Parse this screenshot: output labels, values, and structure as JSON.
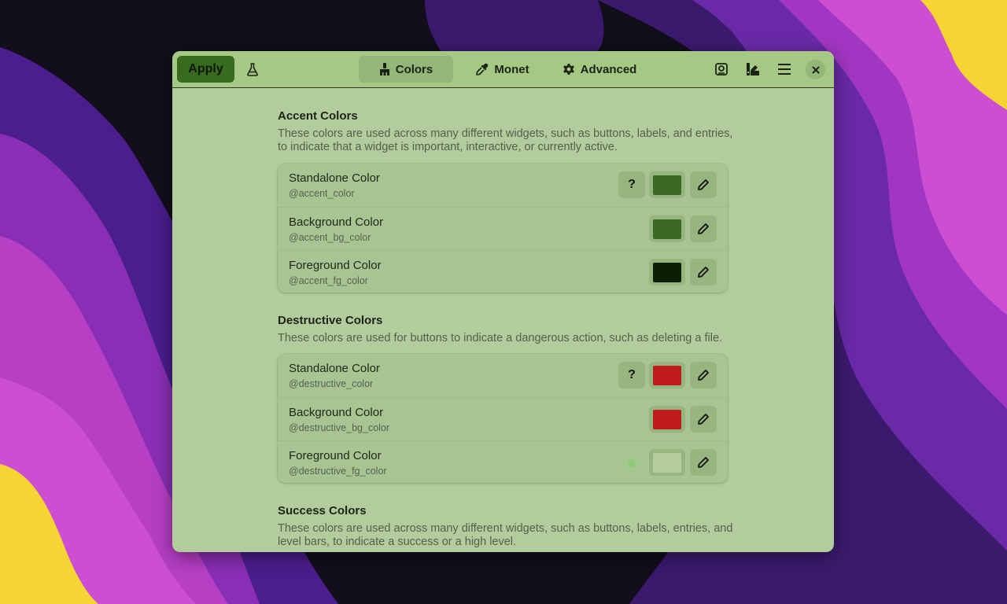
{
  "window": {
    "header": {
      "apply_label": "Apply",
      "tabs": [
        {
          "label": "Colors",
          "icon": "brush-icon",
          "active": true
        },
        {
          "label": "Monet",
          "icon": "eyedropper-icon",
          "active": false
        },
        {
          "label": "Advanced",
          "icon": "gear-icon",
          "active": false
        }
      ],
      "icons": [
        "flask-icon",
        "preset-icon",
        "palette-icon",
        "hamburger-menu-icon",
        "close-icon"
      ]
    },
    "sections": [
      {
        "title": "Accent Colors",
        "description": "These colors are used across many different widgets, such as buttons, labels, and entries, to indicate that a widget is important, interactive, or currently active.",
        "rows": [
          {
            "title": "Standalone Color",
            "subtitle": "@accent_color",
            "swatch": "#3b6b22",
            "help": true
          },
          {
            "title": "Background Color",
            "subtitle": "@accent_bg_color",
            "swatch": "#3b6b22",
            "help": false
          },
          {
            "title": "Foreground Color",
            "subtitle": "@accent_fg_color",
            "swatch": "#0a1f04",
            "help": false
          }
        ]
      },
      {
        "title": "Destructive Colors",
        "description": "These colors are used for buttons to indicate a dangerous action, such as deleting a file.",
        "rows": [
          {
            "title": "Standalone Color",
            "subtitle": "@destructive_color",
            "swatch": "#c01c1c",
            "help": true
          },
          {
            "title": "Background Color",
            "subtitle": "@destructive_bg_color",
            "swatch": "#c01c1c",
            "help": false
          },
          {
            "title": "Foreground Color",
            "subtitle": "@destructive_fg_color",
            "swatch": "#b6cc9f",
            "help": false
          }
        ]
      },
      {
        "title": "Success Colors",
        "description": "These colors are used across many different widgets, such as buttons, labels, entries, and level bars, to indicate a success or a high level."
      }
    ],
    "help_glyph": "?",
    "colors": {
      "window_bg": "#b3cc9d",
      "header_bg": "#a5c884",
      "accent": "#386a20"
    }
  }
}
